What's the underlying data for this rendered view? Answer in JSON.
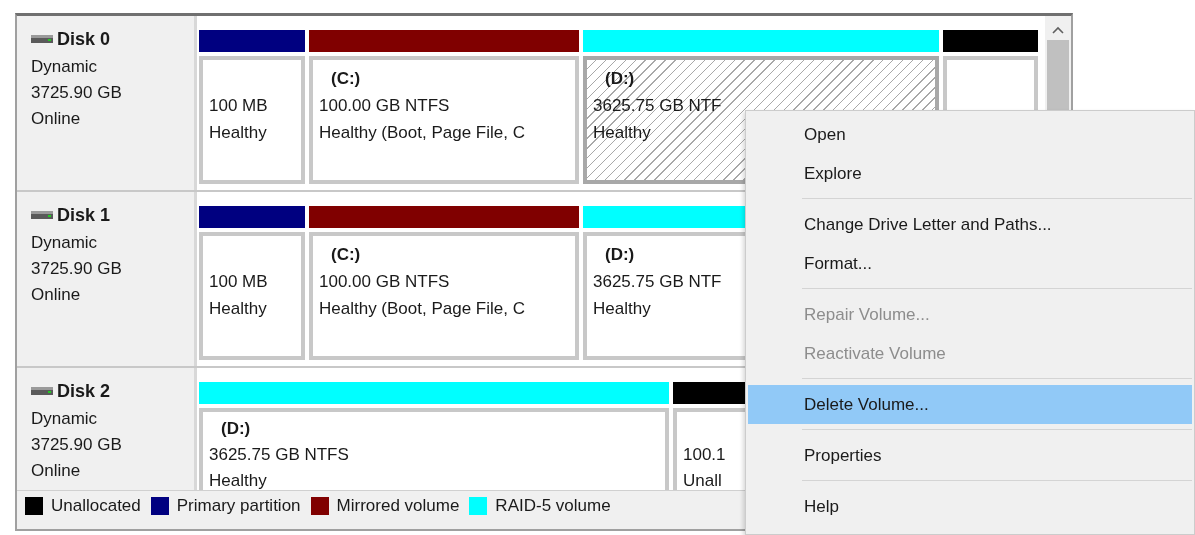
{
  "disks": [
    {
      "name": "Disk 0",
      "type": "Dynamic",
      "size": "3725.90 GB",
      "status": "Online",
      "volumes": [
        {
          "kind": "primary",
          "selected": false,
          "size": "100 MB",
          "status": "Healthy"
        },
        {
          "kind": "mirrored",
          "selected": false,
          "label": "(C:)",
          "size": "100.00 GB NTFS",
          "status": "Healthy (Boot, Page File, C"
        },
        {
          "kind": "raid5",
          "selected": true,
          "label": "(D:)",
          "size": "3625.75 GB NTF",
          "status": "Healthy"
        },
        {
          "kind": "unallocated",
          "selected": false
        }
      ]
    },
    {
      "name": "Disk 1",
      "type": "Dynamic",
      "size": "3725.90 GB",
      "status": "Online",
      "volumes": [
        {
          "kind": "primary",
          "selected": false,
          "size": "100 MB",
          "status": "Healthy"
        },
        {
          "kind": "mirrored",
          "selected": false,
          "label": "(C:)",
          "size": "100.00 GB NTFS",
          "status": "Healthy (Boot, Page File, C"
        },
        {
          "kind": "raid5",
          "selected": false,
          "label": "(D:)",
          "size": "3625.75 GB NTF",
          "status": "Healthy"
        }
      ]
    },
    {
      "name": "Disk 2",
      "type": "Dynamic",
      "size": "3725.90 GB",
      "status": "Online",
      "volumes": [
        {
          "kind": "raid5",
          "selected": false,
          "label": "(D:)",
          "size": "3625.75 GB NTFS",
          "status": "Healthy"
        },
        {
          "kind": "unallocated",
          "selected": false,
          "size": "100.1",
          "status": "Unall"
        }
      ]
    }
  ],
  "legend": [
    {
      "kind": "unallocated",
      "label": "Unallocated"
    },
    {
      "kind": "primary",
      "label": "Primary partition"
    },
    {
      "kind": "mirrored",
      "label": "Mirrored volume"
    },
    {
      "kind": "raid5",
      "label": "RAID-5 volume"
    }
  ],
  "context_menu": {
    "sections": [
      [
        {
          "label": "Open",
          "disabled": false,
          "selected": false
        },
        {
          "label": "Explore",
          "disabled": false,
          "selected": false
        }
      ],
      [
        {
          "label": "Change Drive Letter and Paths...",
          "disabled": false,
          "selected": false
        },
        {
          "label": "Format...",
          "disabled": false,
          "selected": false
        }
      ],
      [
        {
          "label": "Repair Volume...",
          "disabled": true,
          "selected": false
        },
        {
          "label": "Reactivate Volume",
          "disabled": true,
          "selected": false
        }
      ],
      [
        {
          "label": "Delete Volume...",
          "disabled": false,
          "selected": true
        }
      ],
      [
        {
          "label": "Properties",
          "disabled": false,
          "selected": false
        }
      ],
      [
        {
          "label": "Help",
          "disabled": false,
          "selected": false
        }
      ]
    ]
  }
}
